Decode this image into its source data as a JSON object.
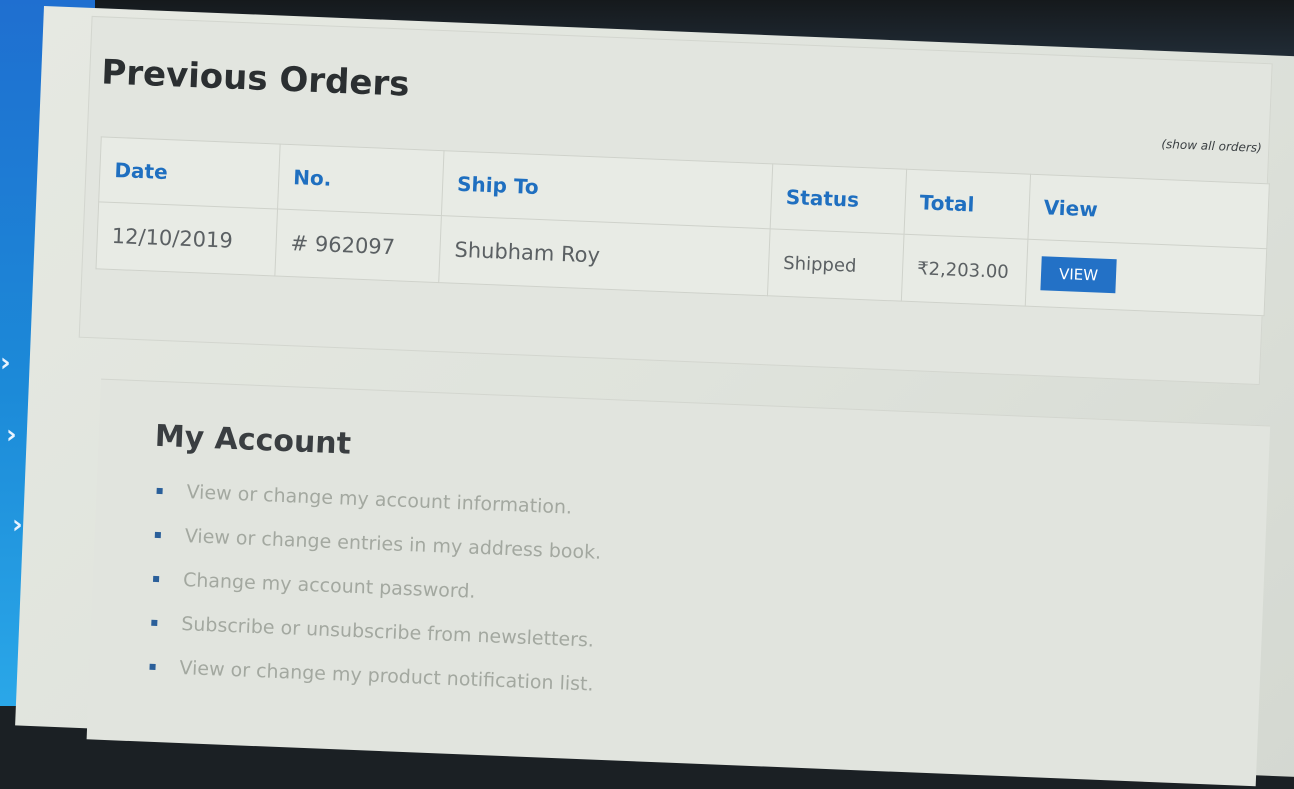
{
  "previous_orders": {
    "title": "Previous Orders",
    "show_all_link": "(show all orders)",
    "columns": [
      "Date",
      "No.",
      "Ship To",
      "Status",
      "Total",
      "View"
    ],
    "rows": [
      {
        "date": "12/10/2019",
        "number": "# 962097",
        "ship_to": "Shubham Roy",
        "status": "Shipped",
        "total": "₹2,203.00",
        "view_label": "VIEW"
      }
    ]
  },
  "my_account": {
    "title": "My Account",
    "links": [
      "View or change my account information.",
      "View or change entries in my address book.",
      "Change my account password.",
      "Subscribe or unsubscribe from newsletters.",
      "View or change my product notification list."
    ]
  },
  "sidebar": {
    "icons": [
      "chevron-right-icon",
      "chevron-right-icon",
      "chevron-right-icon",
      "chevron-right-icon"
    ]
  },
  "colors": {
    "accent_blue": "#2371c6",
    "header_text_blue": "#1f6fc0",
    "sidebar_blue": "#1f6fd0"
  }
}
